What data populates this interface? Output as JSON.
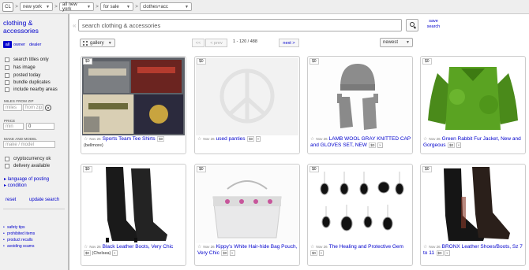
{
  "topbar": {
    "logo": "CL",
    "crumbs": [
      "new york",
      "all new york",
      "for sale",
      "clothes+acc"
    ],
    "separator": ">"
  },
  "sidebar": {
    "title": "clothing & accessories",
    "filter_all": "all",
    "filter_owner": "owner",
    "filter_dealer": "dealer",
    "checkboxes": [
      "search titles only",
      "has image",
      "posted today",
      "bundle duplicates",
      "include nearby areas"
    ],
    "miles_label": "MILES FROM ZIP",
    "miles_placeholder": "miles",
    "zip_placeholder": "from zip",
    "price_label": "PRICE",
    "min_placeholder": "min",
    "max_value": "0",
    "make_label": "MAKE AND MODEL",
    "make_placeholder": "make / model",
    "checkboxes2": [
      "cryptocurrency ok",
      "delivery available"
    ],
    "language_link": "▸ language of posting",
    "condition_link": "▸ condition",
    "reset_label": "reset",
    "update_label": "update search",
    "footer_links": [
      "safety tips",
      "prohibited items",
      "product recalls",
      "avoiding scams"
    ]
  },
  "search": {
    "back": "«",
    "query": "search clothing & accessories",
    "save_label": "save search"
  },
  "controls": {
    "view": "gallery",
    "first": "<<",
    "prev": "< prev",
    "range": "1 - 120 / 488",
    "next": "next >",
    "sort": "newest"
  },
  "listings": [
    {
      "price": "$0",
      "date": "Nov 26",
      "title": "Sports Team Tee Shirts",
      "hood": "(bellmore)",
      "tag": "$0",
      "x": ""
    },
    {
      "price": "$0",
      "date": "Nov 26",
      "title": "used panties",
      "hood": "",
      "tag": "$0",
      "x": "×"
    },
    {
      "price": "$0",
      "date": "Nov 26",
      "title": "LAMB WOOL GRAY KNITTED CAP and GLOVES SET, NEW",
      "hood": "",
      "tag": "$0",
      "x": "×"
    },
    {
      "price": "$0",
      "date": "Nov 26",
      "title": "Green Rabbit Fur Jacket, New and Gorgeous",
      "hood": "",
      "tag": "$0",
      "x": "×"
    },
    {
      "price": "$0",
      "date": "Nov 26",
      "title": "Black Leather Boots, Very Chic",
      "hood": "(Chelsea)",
      "tag": "$0",
      "x": "×"
    },
    {
      "price": "$0",
      "date": "Nov 26",
      "title": "Kippy's White Hair-hide Bag Pouch, Very Chic",
      "hood": "",
      "tag": "$0",
      "x": "×"
    },
    {
      "price": "$0",
      "date": "Nov 26",
      "title": "The Healing and Protective Gem",
      "hood": "",
      "tag": "$0",
      "x": "×"
    },
    {
      "price": "$0",
      "date": "Nov 26",
      "title": "BRONX Leather Shoes/Boots, Sz 7 to 11",
      "hood": "",
      "tag": "$0",
      "x": "×"
    }
  ]
}
